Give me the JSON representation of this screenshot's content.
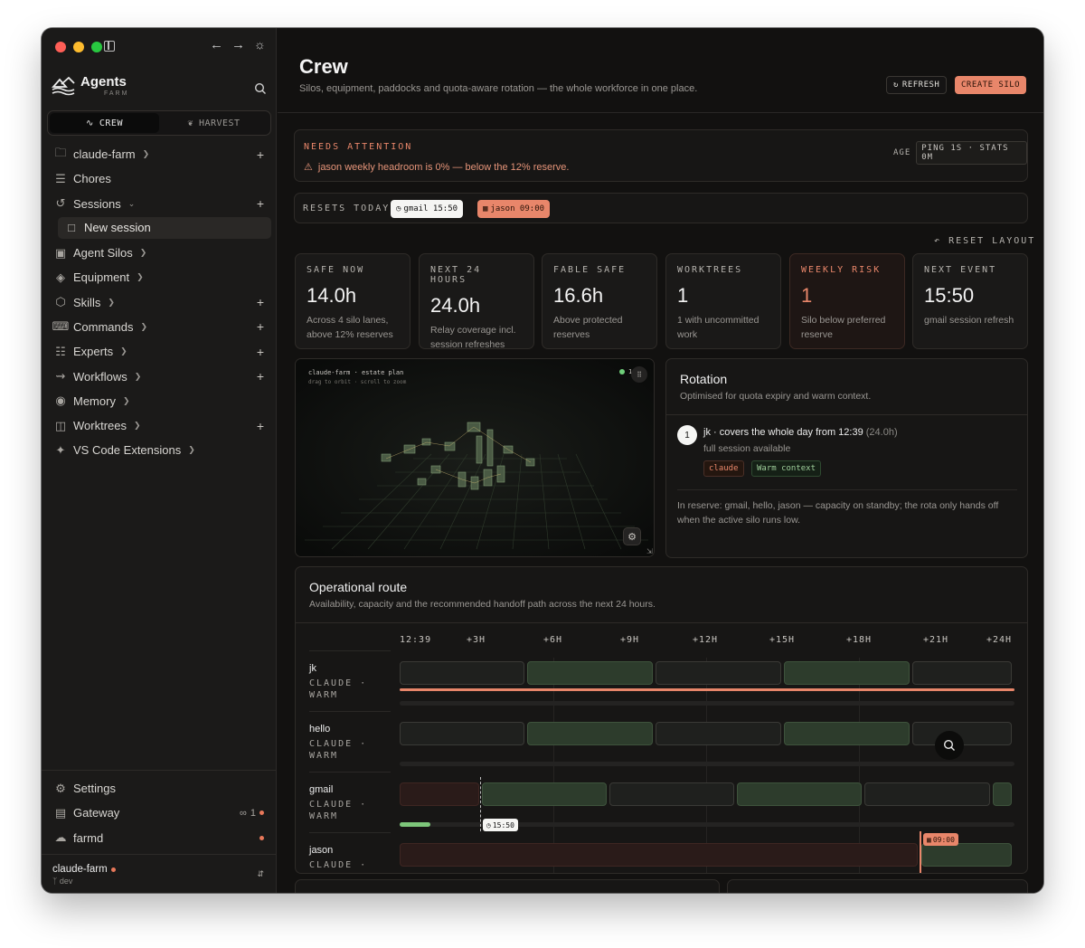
{
  "sidebar": {
    "brand": {
      "name": "Agents",
      "sub": "FARM"
    },
    "mode_tabs": [
      {
        "label": "CREW",
        "active": true
      },
      {
        "label": "HARVEST",
        "active": false
      }
    ],
    "items": [
      {
        "label": "claude-farm",
        "icon": "folder-icon",
        "chevron": true,
        "plus": true
      },
      {
        "label": "Chores",
        "icon": "list-icon",
        "chevron": false,
        "plus": false
      },
      {
        "label": "Sessions",
        "icon": "history-icon",
        "chevron": true,
        "expanded": true,
        "plus": true
      },
      {
        "label": "Agent Silos",
        "icon": "chip-icon",
        "chevron": true,
        "plus": false
      },
      {
        "label": "Equipment",
        "icon": "layers-icon",
        "chevron": true,
        "plus": false
      },
      {
        "label": "Skills",
        "icon": "hexagon-icon",
        "chevron": true,
        "plus": true
      },
      {
        "label": "Commands",
        "icon": "terminal-icon",
        "chevron": true,
        "plus": true
      },
      {
        "label": "Experts",
        "icon": "robot-icon",
        "chevron": true,
        "plus": true
      },
      {
        "label": "Workflows",
        "icon": "workflow-icon",
        "chevron": true,
        "plus": true
      },
      {
        "label": "Memory",
        "icon": "brain-icon",
        "chevron": true,
        "plus": false
      },
      {
        "label": "Worktrees",
        "icon": "tree-icon",
        "chevron": true,
        "plus": true
      },
      {
        "label": "VS Code Extensions",
        "icon": "puzzle-icon",
        "chevron": true,
        "plus": false
      }
    ],
    "new_session": "New session",
    "footer": [
      {
        "label": "Settings",
        "icon": "gear-icon"
      },
      {
        "label": "Gateway",
        "icon": "server-icon",
        "badge": "1"
      },
      {
        "label": "farmd",
        "icon": "cloud-icon"
      }
    ],
    "workspace": {
      "name": "claude-farm",
      "branch": "dev"
    }
  },
  "header": {
    "title": "Crew",
    "subtitle": "Silos, equipment, paddocks and quota-aware rotation — the whole workforce in one place.",
    "refresh_label": "REFRESH",
    "create_label": "CREATE SILO"
  },
  "attention": {
    "title": "NEEDS ATTENTION",
    "message": "jason weekly headroom is 0% — below the 12% reserve.",
    "age_label": "AGE",
    "age_value": "PING 1S · STATS 0M"
  },
  "resets": {
    "label": "RESETS TODAY",
    "chips": [
      {
        "text": "gmail 15:50",
        "style": "white"
      },
      {
        "text": "jason 09:00",
        "style": "orange"
      }
    ]
  },
  "reset_layout": "RESET LAYOUT",
  "stats": [
    {
      "label": "SAFE NOW",
      "value": "14.0h",
      "desc": "Across 4 silo lanes, above 12% reserves",
      "risk": false
    },
    {
      "label": "NEXT 24 HOURS",
      "value": "24.0h",
      "desc": "Relay coverage incl. session refreshes",
      "risk": false
    },
    {
      "label": "FABLE SAFE",
      "value": "16.6h",
      "desc": "Above protected reserves",
      "risk": false
    },
    {
      "label": "WORKTREES",
      "value": "1",
      "desc": "1 with uncommitted work",
      "risk": false
    },
    {
      "label": "WEEKLY RISK",
      "value": "1",
      "desc": "Silo below preferred reserve",
      "risk": true
    },
    {
      "label": "NEXT EVENT",
      "value": "15:50",
      "desc": "gmail session refresh",
      "risk": false
    }
  ],
  "estate": {
    "title": "claude-farm · estate plan",
    "hint": "drag to orbit · scroll to zoom",
    "status": "1"
  },
  "rotation": {
    "title": "Rotation",
    "subtitle": "Optimised for quota expiry and warm context.",
    "step_number": "1",
    "line": "jk · covers the whole day from 12:39",
    "line_dim": "(24.0h)",
    "availability": "full session available",
    "tags": [
      "claude",
      "Warm context"
    ],
    "reserve": "In reserve: gmail, hello, jason — capacity on standby; the rota only hands off when the active silo runs low."
  },
  "route": {
    "title": "Operational route",
    "subtitle": "Availability, capacity and the recommended handoff path across the next 24 hours.",
    "ticks": [
      "12:39",
      "+3H",
      "+6H",
      "+9H",
      "+12H",
      "+15H",
      "+18H",
      "+21H",
      "+24H"
    ],
    "lanes": [
      {
        "name": "jk",
        "meta": "CLAUDE · WARM",
        "segments": [
          "dark",
          "green",
          "dark",
          "green",
          "dark"
        ],
        "fill_pct": 100,
        "fill_color": "#e8866a"
      },
      {
        "name": "hello",
        "meta": "CLAUDE · WARM",
        "segments": [
          "dark",
          "green",
          "dark",
          "green",
          "dark"
        ],
        "fill_pct": 0,
        "fill_color": "#242322"
      },
      {
        "name": "gmail",
        "meta": "CLAUDE · WARM",
        "segments": [
          "red",
          "green",
          "dark",
          "green",
          "dark",
          "green"
        ],
        "fill_pct": 5,
        "fill_color": "#7dc67a"
      },
      {
        "name": "jason",
        "meta": "CLAUDE ·",
        "segments": [
          "red",
          "green"
        ],
        "fill_pct": 0,
        "fill_color": "#242322"
      }
    ],
    "markers": [
      {
        "text": "15:50",
        "style": "white"
      },
      {
        "text": "09:00",
        "style": "orange"
      }
    ]
  }
}
